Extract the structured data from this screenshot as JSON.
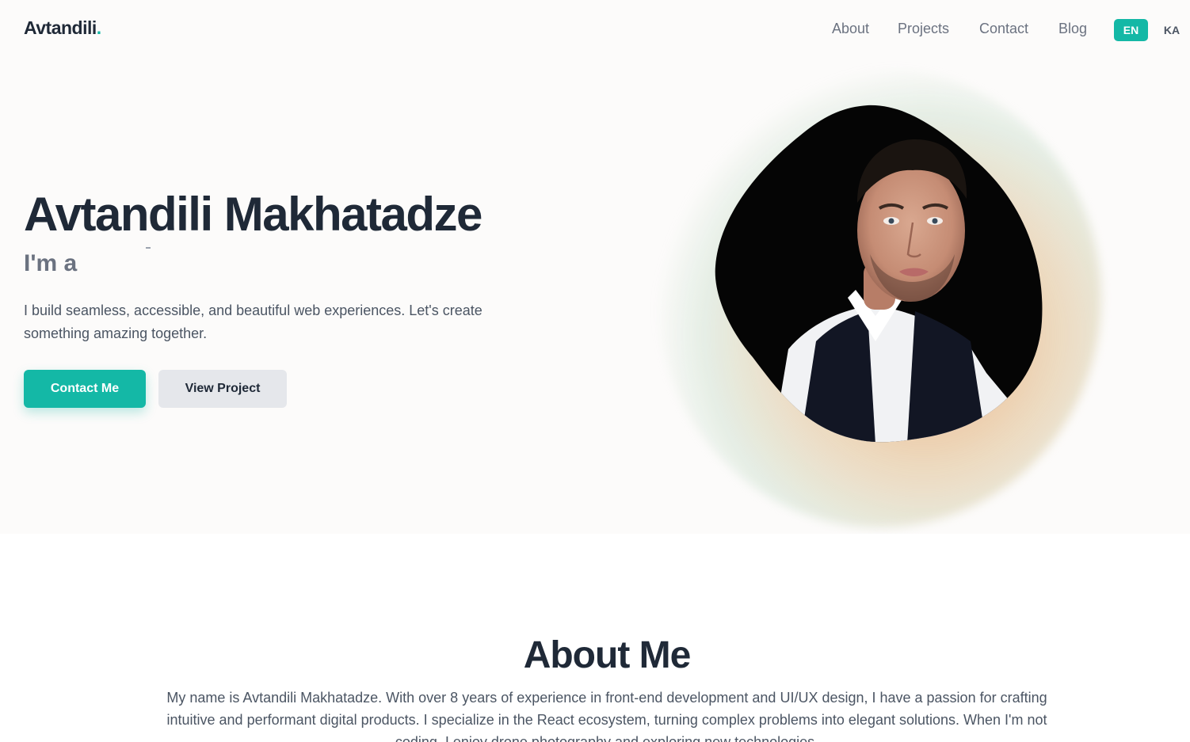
{
  "header": {
    "brand": "Avtandili",
    "brand_dot": ".",
    "nav": [
      {
        "label": "About"
      },
      {
        "label": "Projects"
      },
      {
        "label": "Contact"
      },
      {
        "label": "Blog"
      }
    ],
    "languages": {
      "active": "EN",
      "other": "KA"
    }
  },
  "hero": {
    "title": "Avtandili Makhatadze",
    "role_prefix": "I'm a",
    "description": "I build seamless, accessible, and beautiful web experiences. Let's create something amazing together.",
    "primary_button": "Contact Me",
    "secondary_button": "View Project"
  },
  "about": {
    "title": "About Me",
    "text": "My name is Avtandili Makhatadze. With over 8 years of experience in front-end development and UI/UX design, I have a passion for crafting intuitive and performant digital products. I specialize in the React ecosystem, turning complex problems into elegant solutions. When I'm not coding, I enjoy drone photography and exploring new technologies."
  },
  "colors": {
    "accent": "#14b8a6",
    "text_dark": "#1f2937",
    "text_muted": "#6b7280",
    "hero_bg": "#fcfbfa"
  },
  "icons": {
    "portrait": "profile-photo"
  }
}
